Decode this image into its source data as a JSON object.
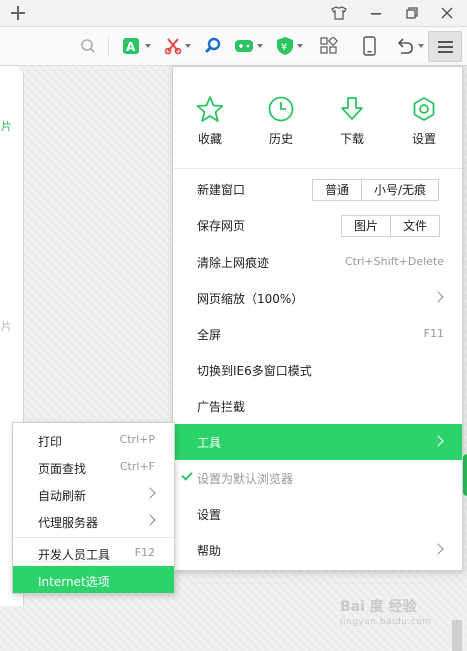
{
  "titlebar": {
    "new_tab_icon": "plus-icon",
    "icons": [
      "shirt-skin-icon",
      "minimize-icon",
      "restore-icon",
      "close-icon"
    ]
  },
  "toolbar": {
    "icons": [
      "search-icon",
      "translate-icon",
      "scissors-icon",
      "magnifier-icon",
      "gamepad-icon",
      "shield-icon",
      "apps-icon",
      "phone-icon",
      "undo-icon",
      "menu-icon"
    ]
  },
  "left_panel": {
    "fragment_1": "片",
    "fragment_2": "片"
  },
  "menu": {
    "quick": [
      {
        "label": "收藏",
        "icon": "star-icon"
      },
      {
        "label": "历史",
        "icon": "clock-icon"
      },
      {
        "label": "下载",
        "icon": "download-arrow-icon"
      },
      {
        "label": "设置",
        "icon": "settings-gear-icon"
      }
    ],
    "new_window": {
      "label": "新建窗口",
      "option_normal": "普通",
      "option_small": "小号/无痕"
    },
    "save_page": {
      "label": "保存网页",
      "option_image": "图片",
      "option_file": "文件"
    },
    "clear_history": {
      "label": "清除上网痕迹",
      "shortcut": "Ctrl+Shift+Delete"
    },
    "zoom": {
      "label": "网页缩放（100%）"
    },
    "fullscreen": {
      "label": "全屏",
      "shortcut": "F11"
    },
    "ie6_mode": {
      "label": "切换到IE6多窗口模式"
    },
    "ad_block": {
      "label": "广告拦截"
    },
    "tools": {
      "label": "工具"
    },
    "default_browser": {
      "label": "设置为默认浏览器"
    },
    "settings": {
      "label": "设置"
    },
    "help": {
      "label": "帮助"
    }
  },
  "submenu": {
    "print": {
      "label": "打印",
      "shortcut": "Ctrl+P"
    },
    "find": {
      "label": "页面查找",
      "shortcut": "Ctrl+F"
    },
    "auto_refresh": {
      "label": "自动刷新"
    },
    "proxy": {
      "label": "代理服务器"
    },
    "devtools": {
      "label": "开发人员工具",
      "shortcut": "F12"
    },
    "internet_options": {
      "label": "Internet选项"
    }
  },
  "watermark": {
    "brand": "Bai 度 经验",
    "url": "jingyan.baidu.com"
  },
  "colors": {
    "accent": "#2cd36a",
    "check": "#2cc463",
    "icon_green": "#2cc463",
    "scissors_red": "#e64545",
    "search_blue": "#1a6fd0"
  }
}
